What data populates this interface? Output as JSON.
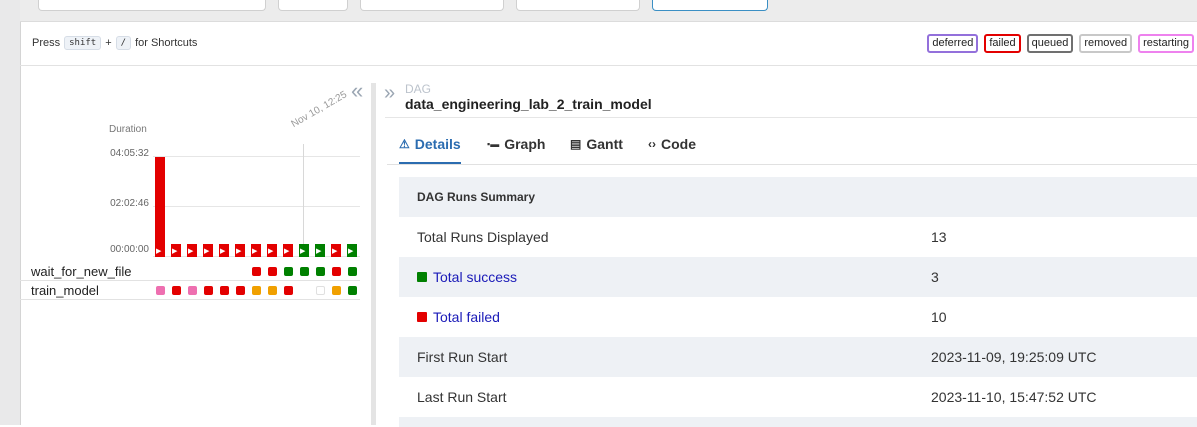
{
  "shortcuts": {
    "press": "Press",
    "shift": "shift",
    "plus": "+",
    "slash": "/",
    "suffix": "for Shortcuts"
  },
  "legend": [
    {
      "label": "deferred",
      "color": "#9370db"
    },
    {
      "label": "failed",
      "color": "#e30000"
    },
    {
      "label": "queued",
      "color": "#707070"
    },
    {
      "label": "removed",
      "color": "#c8c8c8"
    },
    {
      "label": "restarting",
      "color": "#ee82ee"
    }
  ],
  "grid": {
    "collapse_icon": "«",
    "duration_title": "Duration",
    "ticks": [
      "04:05:32",
      "02:02:46",
      "00:00:00"
    ],
    "date_label": "Nov 10, 12:25",
    "tasks": [
      {
        "name": "wait_for_new_file"
      },
      {
        "name": "train_model"
      }
    ]
  },
  "colors": {
    "success": "#008000",
    "failed": "#e30000",
    "up_for_retry": "#f0a000",
    "upstream_failed": "#ee6fb0",
    "none": "#ffffff"
  },
  "dag": {
    "expand_icon": "»",
    "tag": "DAG",
    "id": "data_engineering_lab_2_train_model",
    "tabs": [
      {
        "label": "Details",
        "icon": "warning-triangle-icon",
        "glyph": "⚠"
      },
      {
        "label": "Graph",
        "icon": "graph-icon",
        "glyph": "▪▬"
      },
      {
        "label": "Gantt",
        "icon": "gantt-icon",
        "glyph": "▤"
      },
      {
        "label": "Code",
        "icon": "code-icon",
        "glyph": "‹›"
      }
    ]
  },
  "summary": {
    "title": "DAG Runs Summary",
    "rows": [
      {
        "key": "Total Runs Displayed",
        "value": "13"
      },
      {
        "key": "Total success",
        "value": "3"
      },
      {
        "key": "Total failed",
        "value": "10"
      },
      {
        "key": "First Run Start",
        "value": "2023-11-09, 19:25:09 UTC"
      },
      {
        "key": "Last Run Start",
        "value": "2023-11-10, 15:47:52 UTC"
      }
    ]
  }
}
